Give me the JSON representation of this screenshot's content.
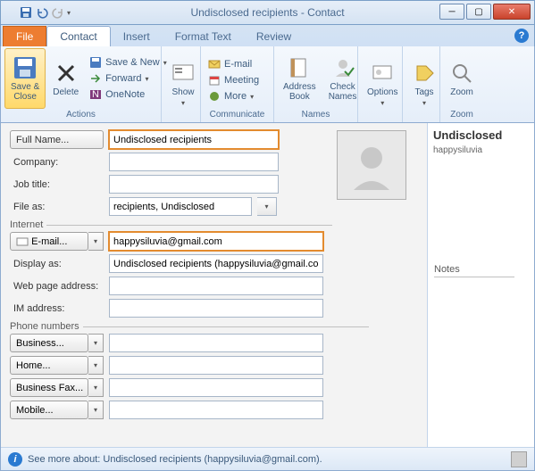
{
  "window": {
    "title": "Undisclosed recipients - Contact"
  },
  "tabs": {
    "file": "File",
    "contact": "Contact",
    "insert": "Insert",
    "format": "Format Text",
    "review": "Review"
  },
  "ribbon": {
    "save_close": "Save &\nClose",
    "delete": "Delete",
    "save_new": "Save & New",
    "forward": "Forward",
    "onenote": "OneNote",
    "actions": "Actions",
    "show": "Show",
    "email": "E-mail",
    "meeting": "Meeting",
    "more": "More",
    "communicate": "Communicate",
    "address_book": "Address\nBook",
    "check_names": "Check\nNames",
    "names": "Names",
    "options": "Options",
    "tags": "Tags",
    "zoom": "Zoom",
    "zoom_group": "Zoom"
  },
  "form": {
    "full_name_btn": "Full Name...",
    "full_name_val": "Undisclosed recipients",
    "company_lbl": "Company:",
    "job_lbl": "Job title:",
    "fileas_lbl": "File as:",
    "fileas_val": "recipients, Undisclosed",
    "internet_lbl": "Internet",
    "email_btn": "E-mail...",
    "email_val": "happysiluvia@gmail.com",
    "display_lbl": "Display as:",
    "display_val": "Undisclosed recipients (happysiluvia@gmail.com)",
    "web_lbl": "Web page address:",
    "im_lbl": "IM address:",
    "phone_lbl": "Phone numbers",
    "business_btn": "Business...",
    "home_btn": "Home...",
    "fax_btn": "Business Fax...",
    "mobile_btn": "Mobile..."
  },
  "side": {
    "name": "Undisclosed",
    "mail": "happysiluvia",
    "notes": "Notes"
  },
  "footer": {
    "text": "See more about: Undisclosed recipients (happysiluvia@gmail.com)."
  }
}
